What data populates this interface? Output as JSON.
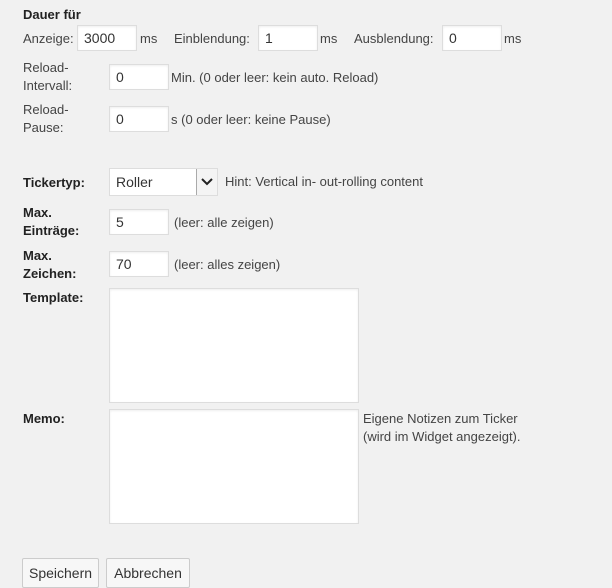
{
  "section_title": "Dauer für",
  "anzeige": {
    "label": "Anzeige:",
    "value": "3000",
    "unit": "ms"
  },
  "einblendung": {
    "label": "Einblendung:",
    "value": "1",
    "unit": "ms"
  },
  "ausblendung": {
    "label": "Ausblendung:",
    "value": "0",
    "unit": "ms"
  },
  "reload_intervall": {
    "label_line1": "Reload-",
    "label_line2": "Intervall:",
    "value": "0",
    "hint": "Min. (0 oder leer: kein auto. Reload)"
  },
  "reload_pause": {
    "label_line1": "Reload-",
    "label_line2": "Pause:",
    "value": "0",
    "hint": "s (0 oder leer: keine Pause)"
  },
  "tickertyp": {
    "label": "Tickertyp:",
    "selected": "Roller",
    "hint": "Hint: Vertical in- out-rolling content",
    "arrow_icon": "chevron-down"
  },
  "max_eintraege": {
    "label_line1": "Max.",
    "label_line2": "Einträge:",
    "value": "5",
    "hint": "(leer: alle zeigen)"
  },
  "max_zeichen": {
    "label_line1": "Max.",
    "label_line2": "Zeichen:",
    "value": "70",
    "hint": "(leer: alles zeigen)"
  },
  "template": {
    "label": "Template:",
    "value": ""
  },
  "memo": {
    "label": "Memo:",
    "value": "",
    "hint_line1": "Eigene Notizen zum Ticker",
    "hint_line2": "(wird im Widget angezeigt)."
  },
  "buttons": {
    "save": "Speichern",
    "cancel": "Abbrechen"
  }
}
